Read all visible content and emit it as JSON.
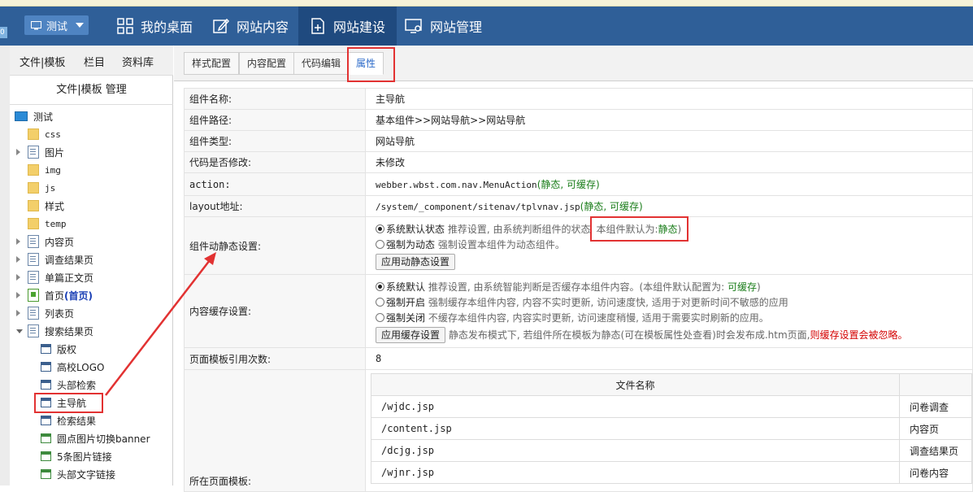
{
  "header": {
    "edge_label": "0",
    "site_button": "测试",
    "nav": [
      "我的桌面",
      "网站内容",
      "网站建设",
      "网站管理"
    ],
    "active_nav": "网站建设"
  },
  "sidebar": {
    "tabs": [
      "文件|模板",
      "栏目",
      "资料库"
    ],
    "title": "文件|模板 管理",
    "tree": [
      {
        "label": "测试",
        "icon": "monitor-icon"
      },
      {
        "label": "css",
        "icon": "folder-icon"
      },
      {
        "label": "图片",
        "icon": "image-folder-icon"
      },
      {
        "label": "img",
        "icon": "folder-icon"
      },
      {
        "label": "js",
        "icon": "folder-icon"
      },
      {
        "label": "样式",
        "icon": "settings-folder-icon"
      },
      {
        "label": "temp",
        "icon": "folder-icon"
      },
      {
        "label": "内容页",
        "icon": "page-icon"
      },
      {
        "label": "调查结果页",
        "icon": "page-icon"
      },
      {
        "label": "单篇正文页",
        "icon": "page-icon"
      },
      {
        "label": "首页",
        "label_strong": "(首页)",
        "icon": "home-page-icon"
      },
      {
        "label": "列表页",
        "icon": "page-icon"
      },
      {
        "label": "搜索结果页",
        "icon": "page-icon"
      },
      {
        "label": "版权",
        "icon": "component-icon"
      },
      {
        "label": "高校LOGO",
        "icon": "component-icon"
      },
      {
        "label": "头部检索",
        "icon": "component-icon"
      },
      {
        "label": "主导航",
        "icon": "component-icon"
      },
      {
        "label": "检索结果",
        "icon": "component-icon"
      },
      {
        "label": "圆点图片切换banner",
        "icon": "component-green-icon"
      },
      {
        "label": "5条图片链接",
        "icon": "component-green-icon"
      },
      {
        "label": "头部文字链接",
        "icon": "component-green-icon"
      }
    ]
  },
  "tabs": [
    "样式配置",
    "内容配置",
    "代码编辑",
    "属性"
  ],
  "props": {
    "name_label": "组件名称:",
    "name_value": "主导航",
    "path_label": "组件路径:",
    "path_value": "基本组件>>网站导航>>网站导航",
    "type_label": "组件类型:",
    "type_value": "网站导航",
    "modified_label": "代码是否修改:",
    "modified_value": "未修改",
    "action_label": "action:",
    "action_value": "webber.wbst.com.nav.MenuAction",
    "action_suffix": "(静态, 可缓存)",
    "layout_label": "layout地址:",
    "layout_value": "/system/_component/sitenav/tplvnav.jsp",
    "layout_suffix": "(静态, 可缓存)",
    "dynamic_label": "组件动静态设置:",
    "dynamic_opt1": "系统默认状态",
    "dynamic_opt1_desc": "推荐设置, 由系统判断组件的状态",
    "dynamic_default_prefix": "本组件默认为:",
    "dynamic_default_value": "静态",
    "dynamic_default_close": ")",
    "dynamic_opt2": "强制为动态",
    "dynamic_opt2_desc": "强制设置本组件为动态组件。",
    "dynamic_button": "应用动静态设置",
    "cache_label": "内容缓存设置:",
    "cache_opt1": "系统默认",
    "cache_opt1_desc": "推荐设置, 由系统智能判断是否缓存本组件内容。(本组件默认配置为:",
    "cache_opt1_value": "可缓存",
    "cache_opt1_close": ")",
    "cache_opt2": "强制开启",
    "cache_opt2_desc": "强制缓存本组件内容, 内容不实时更新, 访问速度快, 适用于对更新时间不敏感的应用",
    "cache_opt3": "强制关闭",
    "cache_opt3_desc": "不缓存本组件内容, 内容实时更新, 访问速度稍慢, 适用于需要实时刷新的应用。",
    "cache_button": "应用缓存设置",
    "cache_note": "静态发布模式下, 若组件所在模板为静态(可在模板属性处查看)时会发布成.htm页面,",
    "cache_note_red": "则缓存设置会被忽略。",
    "refcount_label": "页面模板引用次数:",
    "refcount_value": "8",
    "templates_label": "所在页面模板:",
    "files_header": "文件名称",
    "files": [
      {
        "file": "/wjdc.jsp",
        "page": "问卷调查"
      },
      {
        "file": "/content.jsp",
        "page": "内容页"
      },
      {
        "file": "/dcjg.jsp",
        "page": "调查结果页"
      },
      {
        "file": "/wjnr.jsp",
        "page": "问卷内容"
      }
    ]
  },
  "colors": {
    "navbar": "#2f5f98",
    "nav_active": "#1f4a7f",
    "highlight": "#e23232",
    "green": "#1a7d1a"
  }
}
